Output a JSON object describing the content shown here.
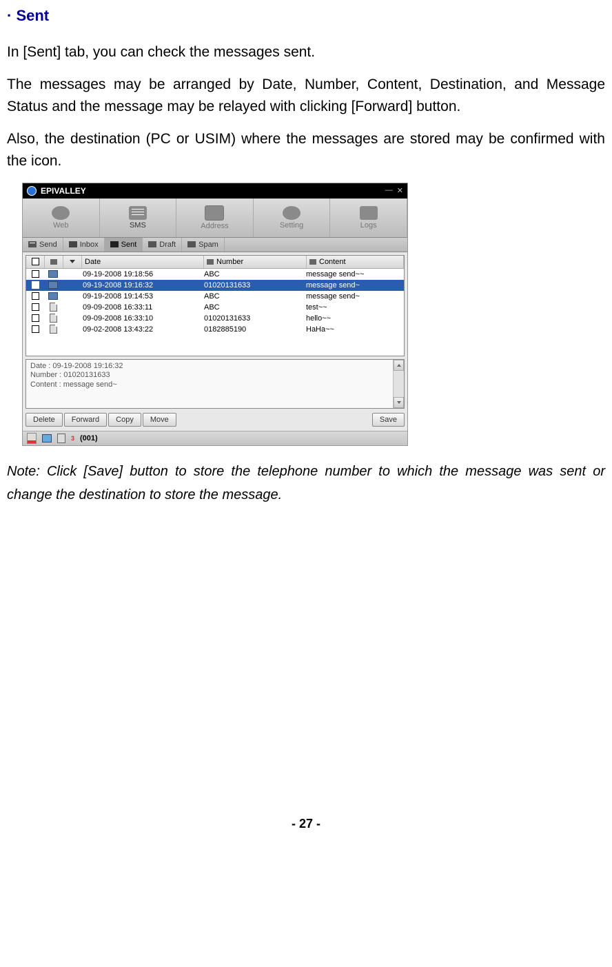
{
  "heading": "· Sent",
  "para1": "In [Sent] tab, you can check the messages sent.",
  "para2": "The messages may be arranged by Date, Number, Content, Destination, and Message Status and the message may be relayed with clicking [Forward] button.",
  "para3": "Also, the destination (PC or USIM) where the messages are stored may be confirmed with the icon.",
  "note": "Note: Click [Save] button to store the telephone number to which the message was sent or change the destination to store the message.",
  "footer": "- 27 -",
  "app": {
    "title": "EPIVALLEY",
    "toolbar": {
      "web": "Web",
      "sms": "SMS",
      "address": "Address",
      "setting": "Setting",
      "logs": "Logs"
    },
    "subtabs": {
      "send": "Send",
      "inbox": "Inbox",
      "sent": "Sent",
      "draft": "Draft",
      "spam": "Spam"
    },
    "columns": {
      "date": "Date",
      "number": "Number",
      "content": "Content"
    },
    "rows": [
      {
        "store": "pc",
        "date": "09-19-2008 19:18:56",
        "number": "ABC",
        "content": "message send~~"
      },
      {
        "store": "pc",
        "date": "09-19-2008 19:16:32",
        "number": "01020131633",
        "content": "message send~",
        "selected": true
      },
      {
        "store": "pc",
        "date": "09-19-2008 19:14:53",
        "number": "ABC",
        "content": "message send~"
      },
      {
        "store": "sim",
        "date": "09-09-2008 16:33:11",
        "number": "ABC",
        "content": "test~~"
      },
      {
        "store": "sim",
        "date": "09-09-2008 16:33:10",
        "number": "01020131633",
        "content": "hello~~"
      },
      {
        "store": "sim",
        "date": "09-02-2008 13:43:22",
        "number": "0182885190",
        "content": "HaHa~~"
      }
    ],
    "preview": {
      "l1": "Date : 09-19-2008 19:16:32",
      "l2": "Number : 01020131633",
      "l3": "Content : message send~"
    },
    "buttons": {
      "delete": "Delete",
      "forward": "Forward",
      "copy": "Copy",
      "move": "Move",
      "save": "Save"
    },
    "status": {
      "count": "(001)"
    }
  }
}
